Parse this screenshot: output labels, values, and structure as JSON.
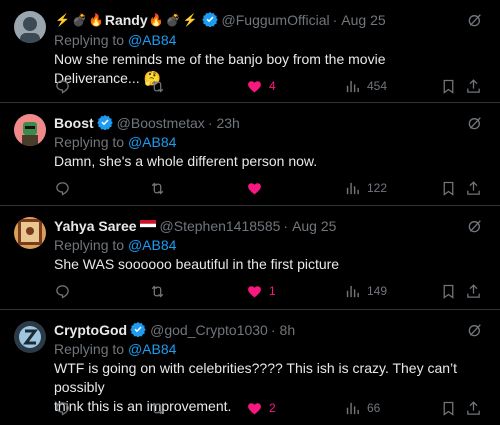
{
  "replies": [
    {
      "display_name": "Randy",
      "name_emojis": [
        "⚡",
        "💣",
        "🔥",
        "🔥",
        "💣",
        "⚡"
      ],
      "verified": true,
      "handle": "@FuggumOfficial",
      "separator": "·",
      "time": "Aug 25",
      "replying_prefix": "Replying to",
      "replying_to": "@AB84",
      "text": "Now she reminds me of the banjo boy from the movie Deliverance...",
      "text_emoji": "🤔",
      "likes": "4",
      "views": "454",
      "avatar_colors": {
        "bg": "#9aa5ad",
        "fg": "#3b4a55"
      }
    },
    {
      "display_name": "Boost",
      "verified": true,
      "handle": "@Boostmetax",
      "separator": "·",
      "time": "23h",
      "replying_prefix": "Replying to",
      "replying_to": "@AB84",
      "text": "Damn, she's a whole different person now.",
      "likes": "",
      "views": "122",
      "avatar_colors": {
        "bg": "#f08a8a",
        "fg": "#3d8b4a"
      }
    },
    {
      "display_name": "Yahya Saree",
      "flag": "yemen-flag",
      "handle": "@Stephen1418585",
      "separator": "·",
      "time": "Aug 25",
      "replying_prefix": "Replying to",
      "replying_to": "@AB84",
      "text": "She WAS soooooo beautiful in the first picture",
      "likes": "1",
      "views": "149",
      "avatar_colors": {
        "bg": "#d8a05a",
        "fg": "#7a3a1e"
      }
    },
    {
      "display_name": "CryptoGod",
      "verified": true,
      "handle": "@god_Crypto1030",
      "separator": "·",
      "time": "8h",
      "replying_prefix": "Replying to",
      "replying_to": "@AB84",
      "text_lines": [
        "WTF is going on with celebrities???? This ish is crazy. They can’t possibly",
        "think this is an improvement."
      ],
      "likes": "2",
      "views": "66",
      "avatar_colors": {
        "bg": "#2b3a46",
        "fg": "#9fc6e0"
      }
    }
  ],
  "colors": {
    "background": "#000000",
    "text": "#e7e9ea",
    "muted": "#71767b",
    "link": "#1d9bf0",
    "like": "#f91880",
    "verified": "#1d9bf0",
    "divider": "#2f3336"
  },
  "icons": [
    "reply-icon",
    "repost-icon",
    "like-icon",
    "views-icon",
    "bookmark-icon",
    "share-icon",
    "grok-icon",
    "verified-badge-icon"
  ]
}
